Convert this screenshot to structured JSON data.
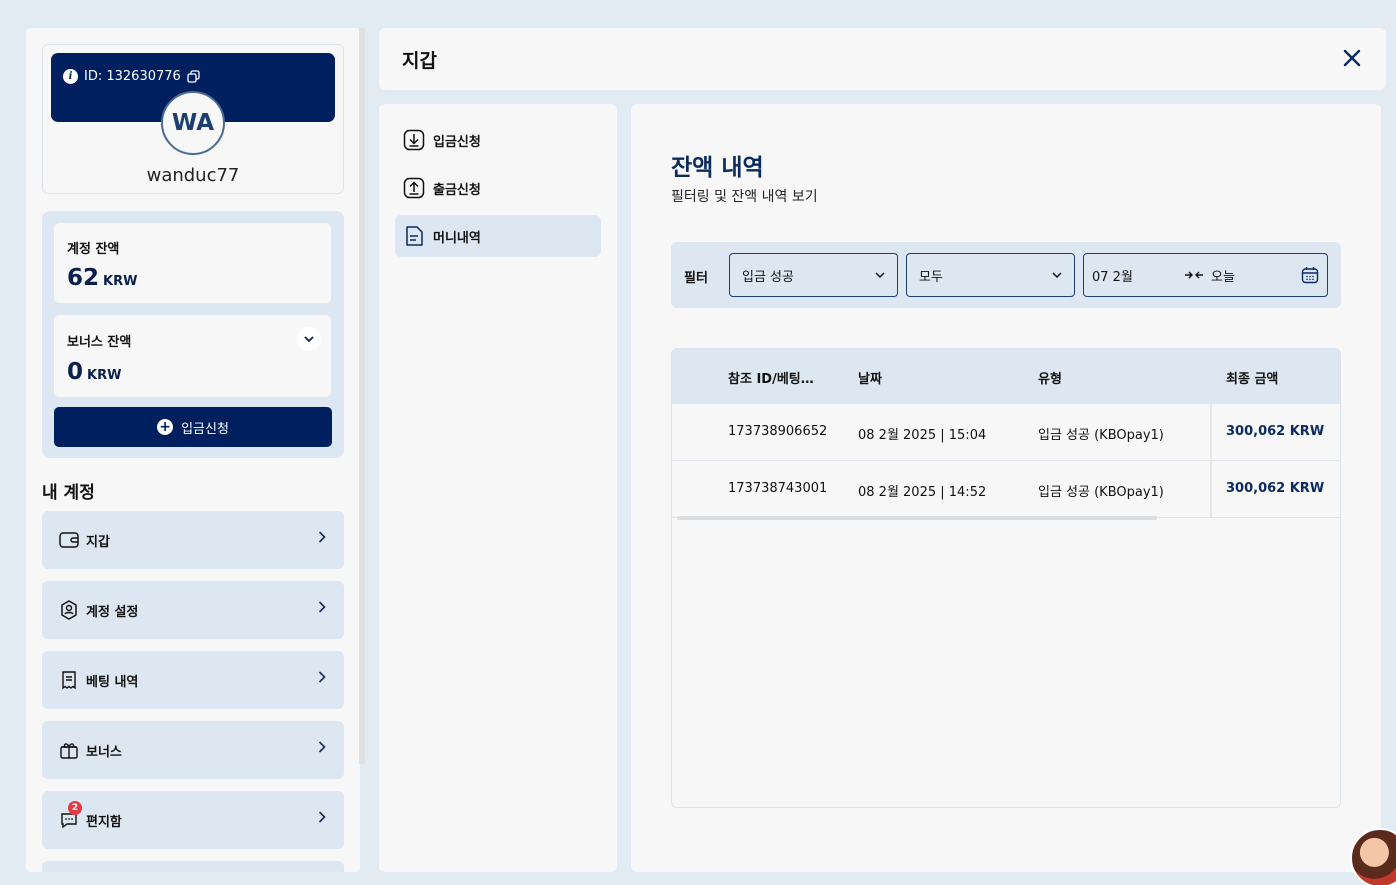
{
  "profile": {
    "id_label": "ID: 132630776",
    "initials": "WA",
    "username": "wanduc77"
  },
  "balances": {
    "account_label": "계정 잔액",
    "account_value": "62",
    "account_unit": "KRW",
    "bonus_label": "보너스 잔액",
    "bonus_value": "0",
    "bonus_unit": "KRW",
    "deposit_button": "입금신청"
  },
  "my_account": {
    "title": "내 계정",
    "items": [
      {
        "label": "지갑",
        "icon": "wallet-icon"
      },
      {
        "label": "계정 설정",
        "icon": "user-shield-icon"
      },
      {
        "label": "베팅 내역",
        "icon": "receipt-icon"
      },
      {
        "label": "보너스",
        "icon": "gift-icon"
      },
      {
        "label": "편지함",
        "icon": "chat-icon",
        "badge": "2"
      }
    ]
  },
  "header": {
    "title": "지갑"
  },
  "wallet_nav": [
    {
      "label": "입금신청",
      "icon": "download-icon"
    },
    {
      "label": "출금신청",
      "icon": "upload-icon"
    },
    {
      "label": "머니내역",
      "icon": "document-icon",
      "active": true
    }
  ],
  "main": {
    "title": "잔액 내역",
    "subtitle": "필터링 및 잔액 내역 보기",
    "filter": {
      "label": "필터",
      "status_value": "입금 성공",
      "type_value": "모두",
      "date_from": "07 2월",
      "date_to": "오늘"
    },
    "table": {
      "headers": [
        "참조 ID/베팅…",
        "날짜",
        "유형",
        "최종 금액"
      ],
      "rows": [
        {
          "ref": "173738906652",
          "date": "08 2월 2025 | 15:04",
          "type": "입금 성공 (KBOpay1)",
          "amount": "300,062 KRW"
        },
        {
          "ref": "173738743001",
          "date": "08 2월 2025 | 14:52",
          "type": "입금 성공 (KBOpay1)",
          "amount": "300,062 KRW"
        }
      ]
    }
  },
  "colors": {
    "navy": "#001f5e",
    "panel_bg": "#dde7f1",
    "page_bg": "#e2eaf2",
    "badge_red": "#e63946"
  }
}
